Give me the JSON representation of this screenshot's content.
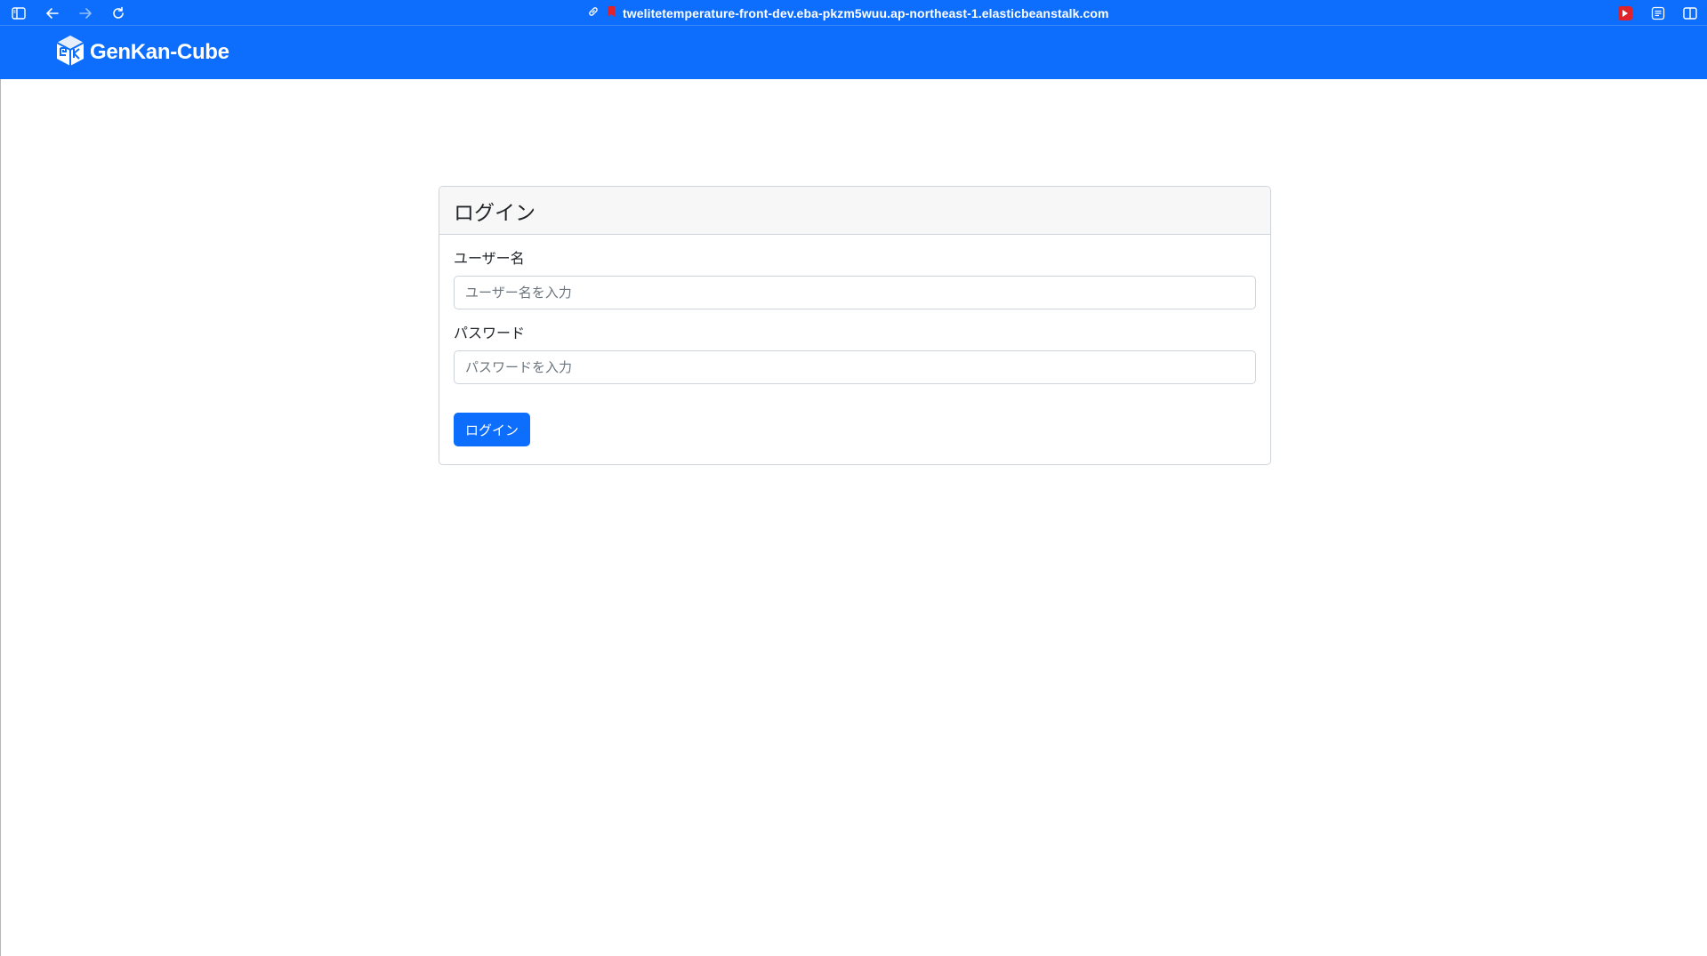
{
  "browser": {
    "url": "twelitetemperature-front-dev.eba-pkzm5wuu.ap-northeast-1.elasticbeanstalk.com",
    "icons": [
      "sidebar-toggle-icon",
      "back-arrow-icon",
      "forward-arrow-icon",
      "reload-icon",
      "link-icon",
      "bookmark-icon",
      "youtube-extension-icon",
      "reader-icon",
      "split-view-icon"
    ]
  },
  "navbar": {
    "brand_name": "GenKan-Cube",
    "logo_icon": "cube-logo-icon"
  },
  "login": {
    "title": "ログイン",
    "username_label": "ユーザー名",
    "username_placeholder": "ユーザー名を入力",
    "username_value": "",
    "password_label": "パスワード",
    "password_placeholder": "パスワードを入力",
    "password_value": "",
    "submit_label": "ログイン"
  },
  "colors": {
    "primary": "#0d6efd",
    "card_header_bg": "#f7f7f7",
    "border": "#cfd4da"
  }
}
